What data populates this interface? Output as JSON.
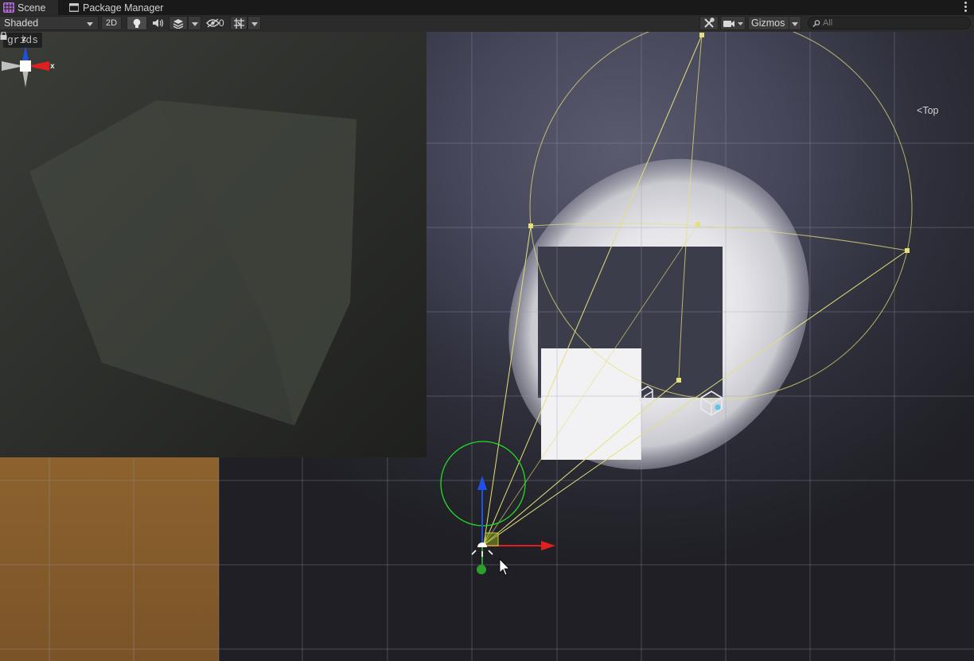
{
  "tabs": [
    {
      "label": "Scene",
      "icon": "scene-grid-icon",
      "active": true
    },
    {
      "label": "Package Manager",
      "icon": "package-icon",
      "active": false
    }
  ],
  "toolbar": {
    "shading_mode": "Shaded",
    "two_d_label": "2D",
    "hidden_count": "0",
    "gizmos_label": "Gizmos",
    "search_placeholder": "All",
    "icons": [
      "light-bulb-icon",
      "audio-icon",
      "effects-icon",
      "visibility-icon",
      "grid-snap-icon",
      "tools-icon",
      "camera-icon"
    ]
  },
  "viewport": {
    "overlay_label": "grids",
    "view_label": "Top",
    "axis_labels": {
      "z": "z",
      "x": "x"
    },
    "colors": {
      "light_gizmo": "#e6e07a",
      "grid_line": "#8a8a9a",
      "axis_x": "#e02020",
      "axis_y": "#2aa02a",
      "axis_z": "#2050e8",
      "orange_floor": "#8a5f2c"
    }
  }
}
